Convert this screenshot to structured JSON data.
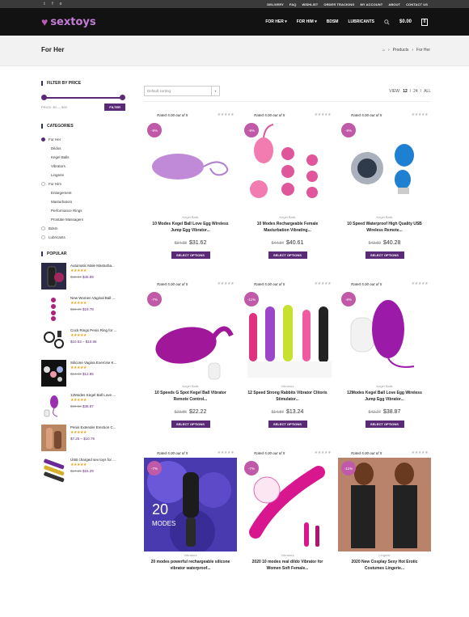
{
  "topbar": {
    "social": [
      "t",
      "f",
      "o"
    ],
    "links": [
      "DELIVERY",
      "FAQ",
      "WISHLIST",
      "ORDER TRACKING",
      "MY ACCOUNT",
      "ABOUT",
      "CONTACT US"
    ]
  },
  "header": {
    "logo": "sextoys",
    "nav": [
      "FOR HER",
      "FOR HIM",
      "BDSM",
      "LUBRICANTS"
    ],
    "cart_total": "$0.00",
    "cart_count": "0"
  },
  "page": {
    "title": "For Her",
    "breadcrumb": [
      "Products",
      "For Her"
    ]
  },
  "sidebar": {
    "filter_title": "FILTER BY PRICE",
    "price_label": "PRICE: $0 — $90",
    "filter_button": "FILTER",
    "categories_title": "CATEGORIES",
    "categories": [
      {
        "label": "For Her",
        "sub": false,
        "on": true
      },
      {
        "label": "Dildos",
        "sub": true
      },
      {
        "label": "Kegel Balls",
        "sub": true
      },
      {
        "label": "Vibrators",
        "sub": true
      },
      {
        "label": "Lingerie",
        "sub": true
      },
      {
        "label": "For Him",
        "sub": false
      },
      {
        "label": "Enlargement",
        "sub": true
      },
      {
        "label": "Masturbators",
        "sub": true
      },
      {
        "label": "Performance Rings",
        "sub": true
      },
      {
        "label": "Prostate Massagers",
        "sub": true
      },
      {
        "label": "Bdsm",
        "sub": false
      },
      {
        "label": "Lubricants",
        "sub": false
      }
    ],
    "popular_title": "POPULAR",
    "popular": [
      {
        "name": "Automatic Male Masturba...",
        "stars": "★★★★★",
        "old": "$42.34",
        "new": "$45.89"
      },
      {
        "name": "New Women Vaginal Ball ...",
        "stars": "★★★★★",
        "old": "$22.49",
        "new": "$19.78"
      },
      {
        "name": "Cock Rings Penis Ring for ...",
        "stars": "★★★★★",
        "old": "",
        "new": "$10.53 – $10.86"
      },
      {
        "name": "Silicone Vagina Exercise K...",
        "stars": "★★★★★",
        "old": "$14.40",
        "new": "$12.85"
      },
      {
        "name": "12Modes Kegel Ball Love ...",
        "stars": "★★★★★",
        "old": "$39.53",
        "new": "$38.87"
      },
      {
        "name": "Penis Extender Erection C...",
        "stars": "★★★★★",
        "old": "",
        "new": "$7.25 – $10.79"
      },
      {
        "name": "USB charged sex toys for ...",
        "stars": "★★★★★",
        "old": "$17.39",
        "new": "$15.29"
      }
    ]
  },
  "main": {
    "sort": "Default sorting",
    "view_label": "VIEW:",
    "view_opts": [
      "12",
      "24",
      "ALL"
    ],
    "rated": "Rated 5.00 out of 5",
    "options": "SELECT OPTIONS",
    "products": [
      {
        "badge": "-8%",
        "cat": "Kegel Balls",
        "title": "10 Modes Kegel Ball Love Egg Wireless Jump Egg Vibrator...",
        "old": "$34.38",
        "new": "$31.62"
      },
      {
        "badge": "-8%",
        "cat": "Kegel Balls",
        "title": "10 Modes Rechargeable Female Masturbation Vibrating...",
        "old": "$44.84",
        "new": "$40.61"
      },
      {
        "badge": "-8%",
        "cat": "Kegel Balls",
        "title": "10 Speed Waterproof High Quality USB Wireless Remote...",
        "old": "$43.50",
        "new": "$40.28"
      },
      {
        "badge": "-7%",
        "cat": "Kegel Balls",
        "title": "10 Speeds G Spot Kegel Ball Vibrator Remote Control...",
        "old": "$23.86",
        "new": "$22.22"
      },
      {
        "badge": "-11%",
        "cat": "Vibrators",
        "title": "12 Speed Strong Rabbits Vibrator Clitoris Stimulator...",
        "old": "$14.87",
        "new": "$13.24"
      },
      {
        "badge": "-8%",
        "cat": "Kegel Balls",
        "title": "12Modes Kegel Ball Love Egg Wireless Jump Egg Vibrator...",
        "old": "$42.27",
        "new": "$38.87"
      },
      {
        "badge": "-7%",
        "cat": "Vibrators",
        "title": "20 modes powerful rechargeable silicone vibrator waterproof...",
        "old": "",
        "new": ""
      },
      {
        "badge": "-7%",
        "cat": "Vibrators",
        "title": "2020 10 modes real dildo Vibrator for Women Soft Female...",
        "old": "",
        "new": ""
      },
      {
        "badge": "-11%",
        "cat": "Lingerie",
        "title": "2020 New Cosplay Sexy Hot Erotic Costumes Lingerie...",
        "old": "",
        "new": ""
      }
    ]
  },
  "colors": {
    "accent": "#5a2a77",
    "badge": "#c05aa8",
    "header": "#121212"
  }
}
